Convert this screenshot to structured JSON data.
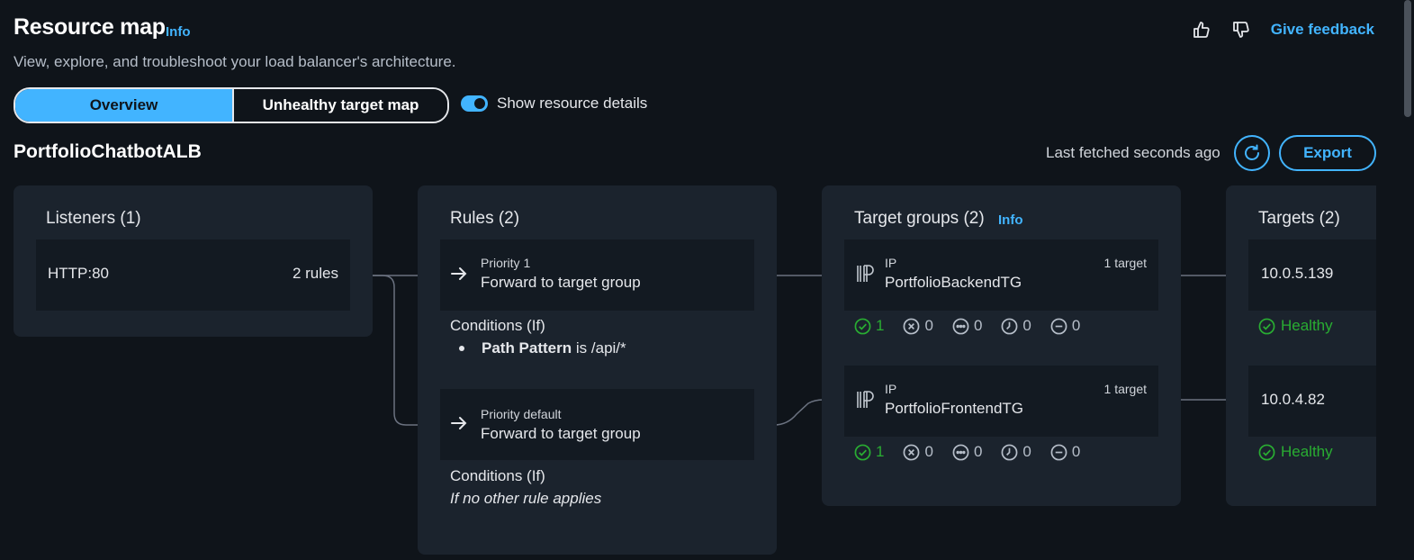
{
  "header": {
    "title": "Resource map",
    "info_label": "Info",
    "subtitle": "View, explore, and troubleshoot your load balancer's architecture.",
    "feedback_label": "Give feedback"
  },
  "view_toggle": {
    "options": [
      "Overview",
      "Unhealthy target map"
    ],
    "selected": "Overview"
  },
  "details_switch": {
    "label": "Show resource details",
    "on": true
  },
  "load_balancer": {
    "name": "PortfolioChatbotALB",
    "last_fetched": "Last fetched seconds ago",
    "export_label": "Export"
  },
  "listeners": {
    "title": "Listeners (1)",
    "items": [
      {
        "name": "HTTP:80",
        "rules": "2 rules"
      }
    ]
  },
  "rules": {
    "title": "Rules (2)",
    "items": [
      {
        "priority": "Priority 1",
        "action": "Forward to target group",
        "conditions_title": "Conditions (If)",
        "condition_key": "Path Pattern",
        "condition_op": "is",
        "condition_value": "/api/*"
      },
      {
        "priority": "Priority default",
        "action": "Forward to target group",
        "conditions_title": "Conditions (If)",
        "condition_text": "If no other rule applies"
      }
    ]
  },
  "target_groups": {
    "title": "Target groups (2)",
    "info_label": "Info",
    "items": [
      {
        "type": "IP",
        "name": "PortfolioBackendTG",
        "count": "1 target",
        "healthy": "1",
        "unhealthy": "0",
        "unused": "0",
        "draining": "0",
        "unavailable": "0"
      },
      {
        "type": "IP",
        "name": "PortfolioFrontendTG",
        "count": "1 target",
        "healthy": "1",
        "unhealthy": "0",
        "unused": "0",
        "draining": "0",
        "unavailable": "0"
      }
    ]
  },
  "targets": {
    "title": "Targets (2)",
    "items": [
      {
        "ip": "10.0.5.139",
        "status": "Healthy"
      },
      {
        "ip": "10.0.4.82",
        "status": "Healthy"
      }
    ]
  },
  "colors": {
    "accent": "#42b4ff",
    "healthy": "#29ad32",
    "background": "#0f141a",
    "panel": "#1b232d",
    "card": "#131a22"
  }
}
